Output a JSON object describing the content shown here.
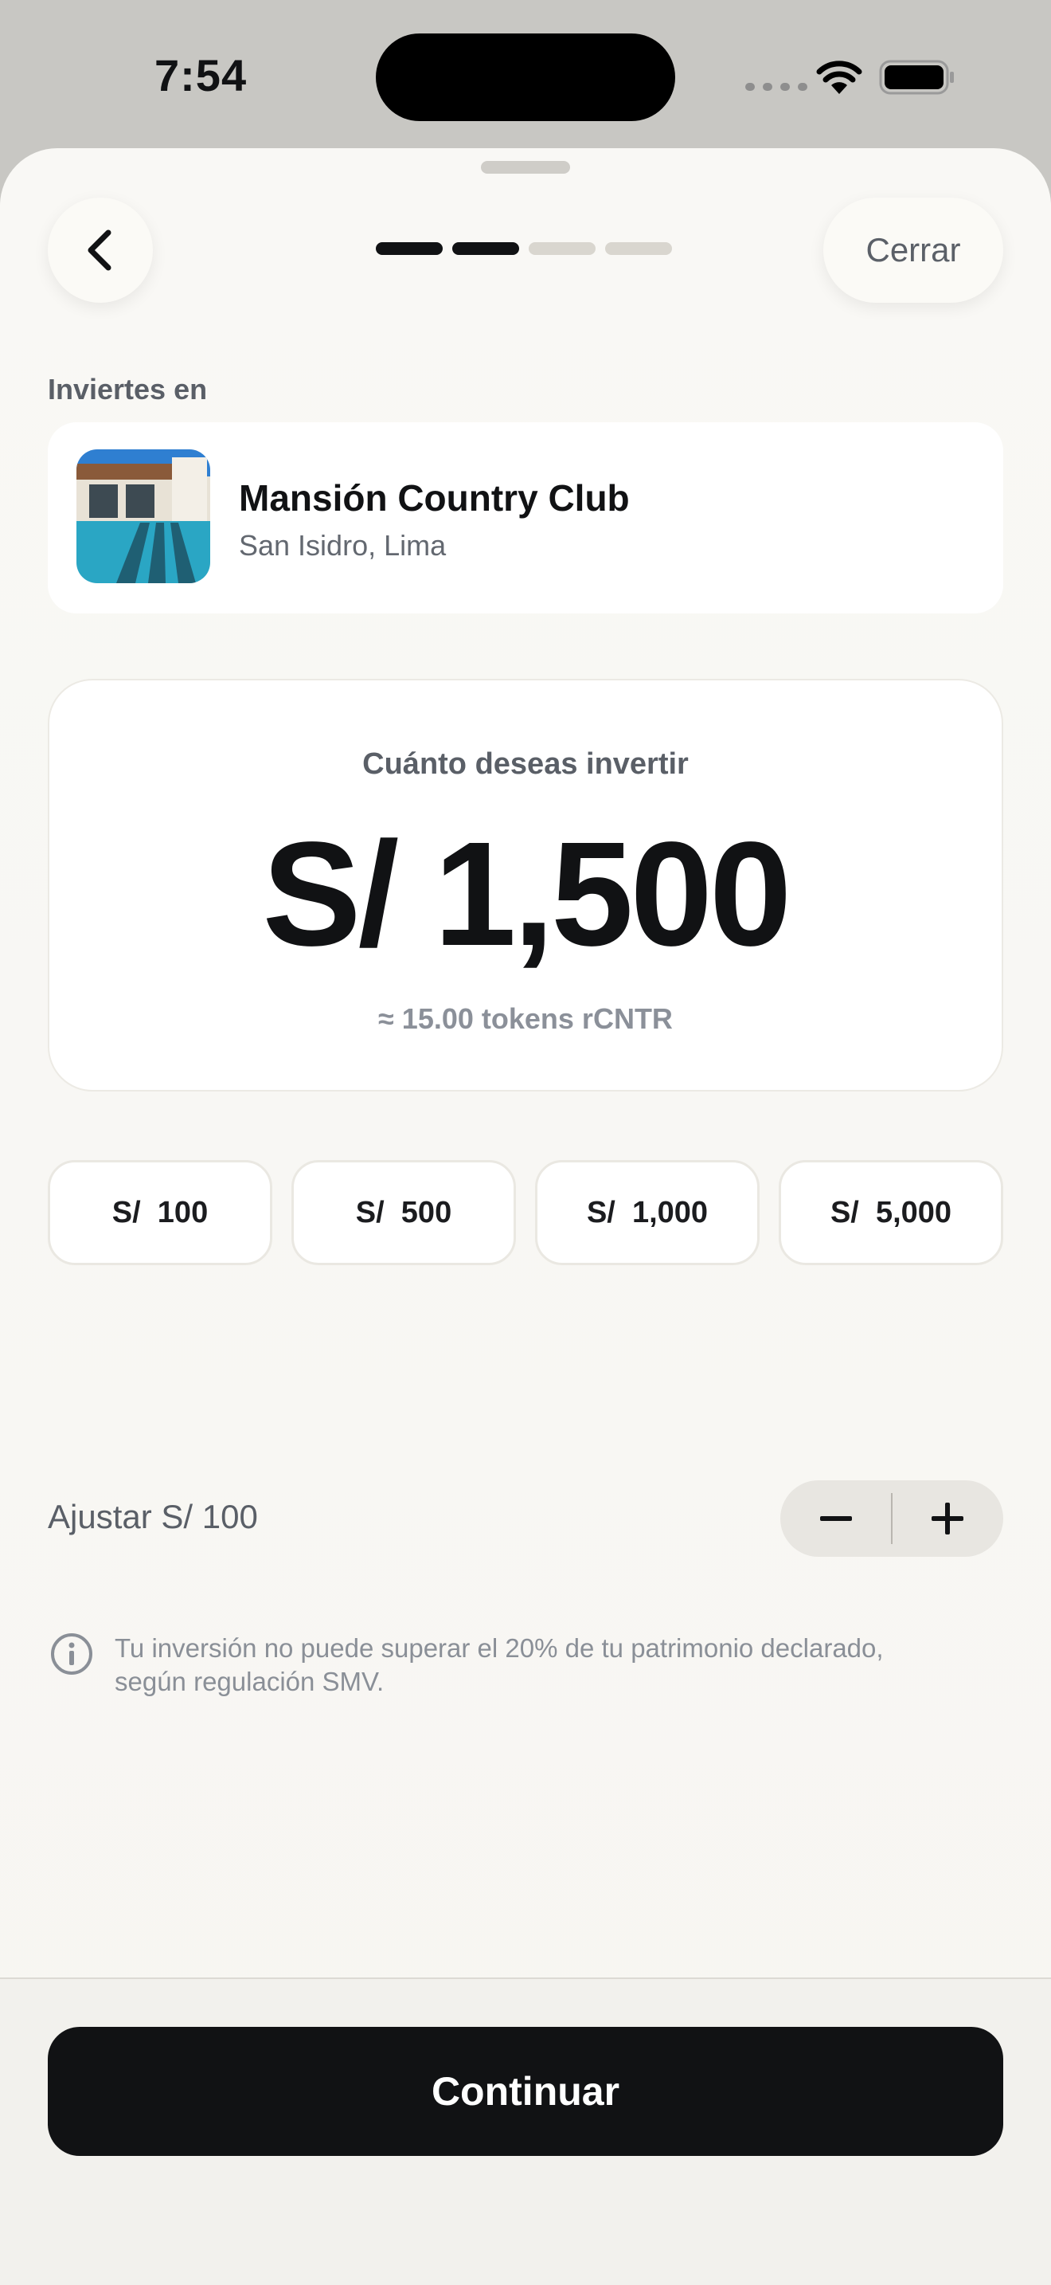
{
  "status_bar": {
    "time": "7:54"
  },
  "header": {
    "back_icon": "chevron-left-icon",
    "close_label": "Cerrar",
    "progress_total": 4,
    "progress_completed": 2
  },
  "property": {
    "section_label": "Inviertes en",
    "name": "Mansión Country Club",
    "location": "San Isidro, Lima"
  },
  "amount": {
    "label": "Cuánto deseas invertir",
    "value": "S/ 1,500",
    "tokens": "≈ 15.00 tokens rCNTR"
  },
  "presets": [
    "S/  100",
    "S/  500",
    "S/  1,000",
    "S/  5,000"
  ],
  "adjust": {
    "label": "Ajustar S/ 100",
    "minus_icon": "minus-icon",
    "plus_icon": "plus-icon"
  },
  "info": {
    "icon": "info-icon",
    "text": "Tu inversión no puede superar el 20% de tu patrimonio declarado, según regulación SMV."
  },
  "footer": {
    "continue_label": "Continuar"
  },
  "colors": {
    "primary": "#111214",
    "background": "#f8f7f3",
    "muted_text": "#5a5f67"
  }
}
